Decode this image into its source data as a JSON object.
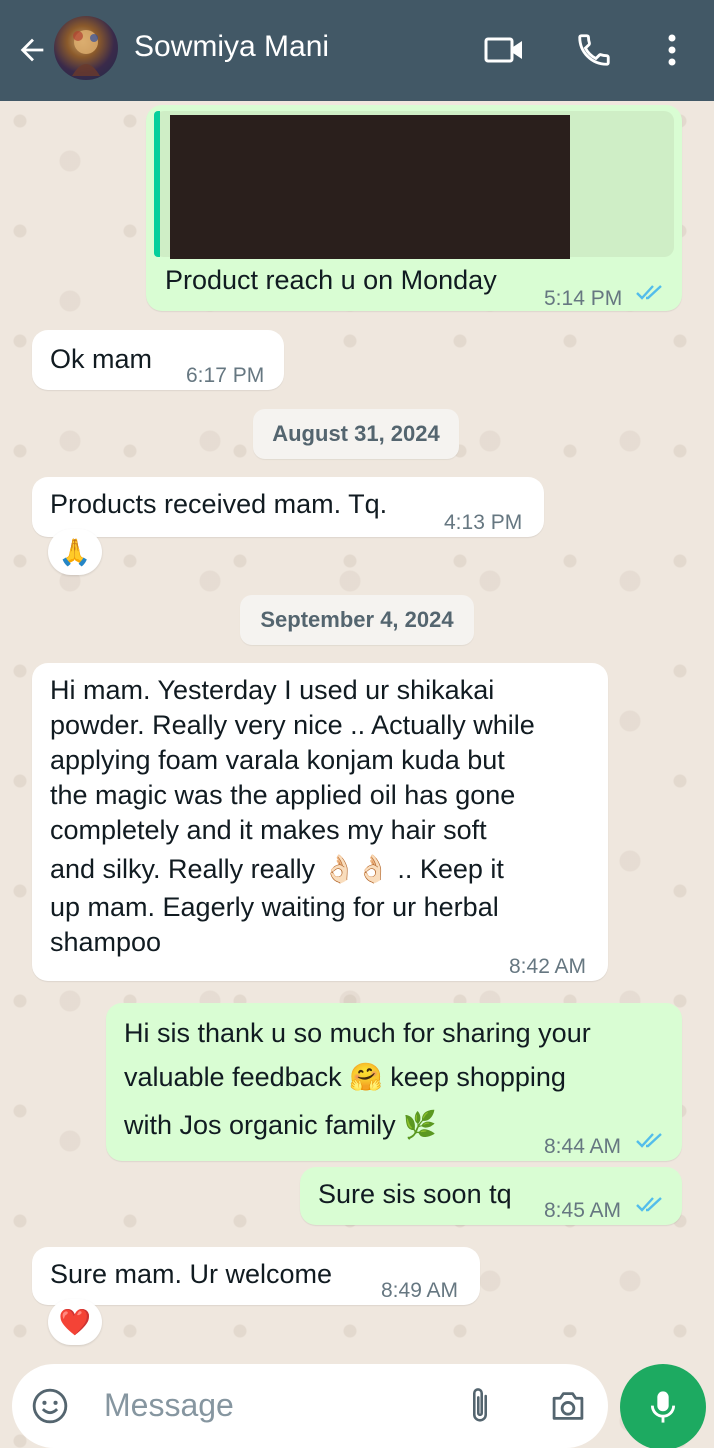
{
  "header": {
    "contact_name": "Sowmiya Mani",
    "icons": [
      "back-arrow-icon",
      "video-call-icon",
      "voice-call-icon",
      "more-options-icon"
    ],
    "bg_color": "#425866"
  },
  "messages": [
    {
      "direction": "out",
      "text": "Product reach u on Monday",
      "time": "5:14 PM",
      "status": "read",
      "has_quoted_media": true
    },
    {
      "direction": "in",
      "text": "Ok mam",
      "time": "6:17 PM"
    },
    {
      "type": "date",
      "text": "August 31, 2024"
    },
    {
      "direction": "in",
      "text": "Products received mam. Tq.",
      "time": "4:13 PM",
      "reaction": "🙏"
    },
    {
      "type": "date",
      "text": "September 4, 2024"
    },
    {
      "direction": "in",
      "lines": [
        "Hi mam. Yesterday I used ur shikakai",
        "powder. Really very nice .. Actually while",
        "applying foam varala konjam kuda but",
        "the magic was the applied oil has gone",
        "completely and it makes my hair soft",
        "and silky. Really really 👌🏻👌🏻 .. Keep it",
        "up mam. Eagerly waiting for ur herbal",
        "shampoo"
      ],
      "time": "8:42 AM"
    },
    {
      "direction": "out",
      "lines": [
        "Hi sis thank u so much for sharing your",
        "valuable feedback 🤗 keep shopping",
        "with Jos organic family 🌿"
      ],
      "time": "8:44 AM",
      "status": "read"
    },
    {
      "direction": "out",
      "text": "Sure sis soon tq",
      "time": "8:45 AM",
      "status": "read"
    },
    {
      "direction": "in",
      "text": "Sure mam. Ur welcome",
      "time": "8:49 AM",
      "reaction": "❤️"
    }
  ],
  "input": {
    "placeholder": "Message",
    "icons": [
      "emoji-icon",
      "attach-icon",
      "camera-icon",
      "mic-icon"
    ]
  },
  "colors": {
    "outgoing_bubble": "#d9fdd3",
    "incoming_bubble": "#ffffff",
    "read_ticks": "#53bdeb",
    "mic_button": "#1daa61",
    "chat_background": "#efe7de"
  }
}
